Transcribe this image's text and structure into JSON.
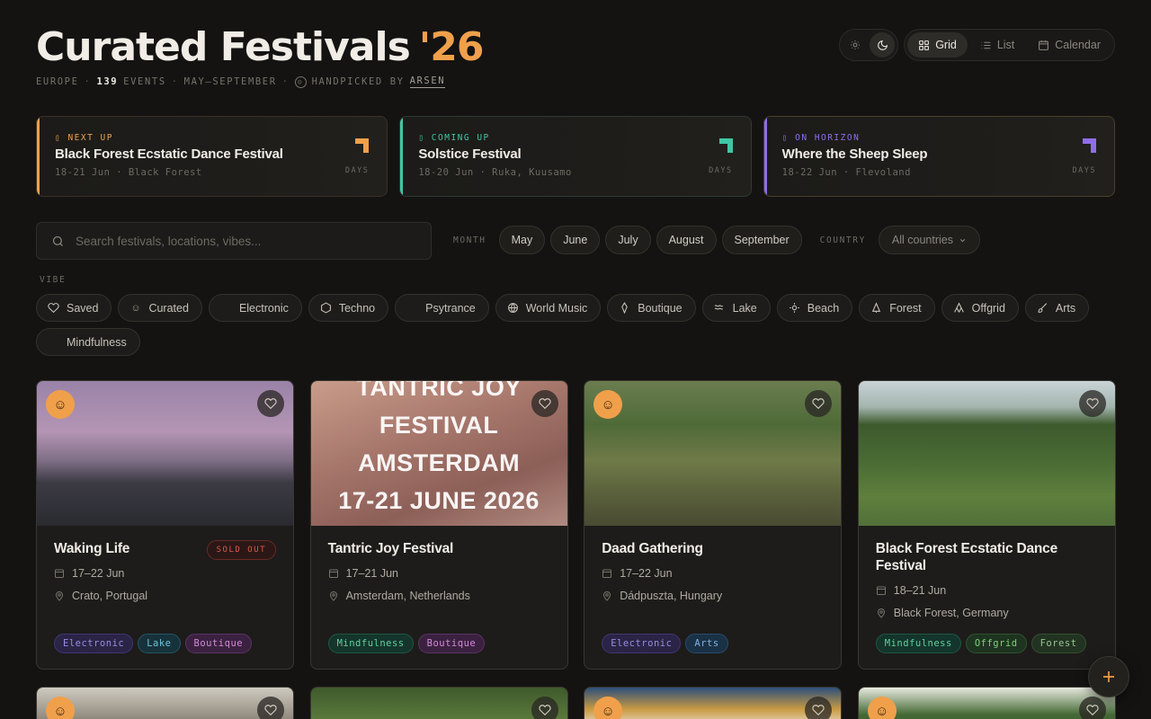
{
  "header": {
    "title": "Curated Festivals",
    "year": "'26",
    "region": "EUROPE",
    "count": "139",
    "count_label": "EVENTS",
    "season": "MAY–SEPTEMBER",
    "handpicked": "HANDPICKED BY",
    "curator": "ARSEN"
  },
  "view": {
    "grid": "Grid",
    "list": "List",
    "calendar": "Calendar",
    "active": "grid",
    "theme": "dark"
  },
  "countdowns": [
    {
      "kicker": "NEXT UP",
      "name": "Black Forest Ecstatic Dance Festival",
      "meta": "18-21 Jun · Black Forest",
      "days_label": "DAYS",
      "color": "#f0a04b"
    },
    {
      "kicker": "COMING UP",
      "name": "Solstice Festival",
      "meta": "18-20 Jun · Ruka, Kuusamo",
      "days_label": "DAYS",
      "color": "#3fc7a4"
    },
    {
      "kicker": "ON HORIZON",
      "name": "Where the Sheep Sleep",
      "meta": "18-22 Jun · Flevoland",
      "days_label": "DAYS",
      "color": "#8e6ee9"
    }
  ],
  "search": {
    "placeholder": "Search festivals, locations, vibes..."
  },
  "filters": {
    "month_label": "MONTH",
    "months": [
      "May",
      "June",
      "July",
      "August",
      "September"
    ],
    "country_label": "COUNTRY",
    "country_value": "All countries"
  },
  "vibe_label": "VIBE",
  "vibes": [
    {
      "label": "Saved",
      "icon": "heart-icon"
    },
    {
      "label": "Curated",
      "icon": "face-icon"
    },
    {
      "label": "Electronic",
      "icon": ""
    },
    {
      "label": "Techno",
      "icon": "hexagon-icon"
    },
    {
      "label": "Psytrance",
      "icon": ""
    },
    {
      "label": "World Music",
      "icon": "globe-icon"
    },
    {
      "label": "Boutique",
      "icon": "gem-icon"
    },
    {
      "label": "Lake",
      "icon": "wave-icon"
    },
    {
      "label": "Beach",
      "icon": "sun-icon"
    },
    {
      "label": "Forest",
      "icon": "tree-icon"
    },
    {
      "label": "Offgrid",
      "icon": "tent-icon"
    },
    {
      "label": "Arts",
      "icon": "brush-icon"
    },
    {
      "label": "Mindfulness",
      "icon": ""
    }
  ],
  "cards": [
    {
      "title": "Waking Life",
      "dates": "17–22 Jun",
      "location": "Crato, Portugal",
      "status": "SOLD OUT",
      "curated": true,
      "tags": [
        "Electronic",
        "Lake",
        "Boutique"
      ]
    },
    {
      "title": "Tantric Joy Festival",
      "dates": "17–21 Jun",
      "location": "Amsterdam, Netherlands",
      "status": "",
      "curated": false,
      "poster": [
        "TANTRIC JOY",
        "FESTIVAL",
        "AMSTERDAM",
        "17-21 JUNE 2026"
      ],
      "tags": [
        "Mindfulness",
        "Boutique"
      ]
    },
    {
      "title": "Daad Gathering",
      "dates": "17–22 Jun",
      "location": "Dádpuszta, Hungary",
      "status": "",
      "curated": true,
      "tags": [
        "Electronic",
        "Arts"
      ]
    },
    {
      "title": "Black Forest Ecstatic Dance Festival",
      "dates": "18–21 Jun",
      "location": "Black Forest, Germany",
      "status": "",
      "curated": false,
      "tags": [
        "Mindfulness",
        "Offgrid",
        "Forest"
      ]
    }
  ],
  "colors": {
    "accent": "#f0a04b",
    "background": "#141312"
  }
}
